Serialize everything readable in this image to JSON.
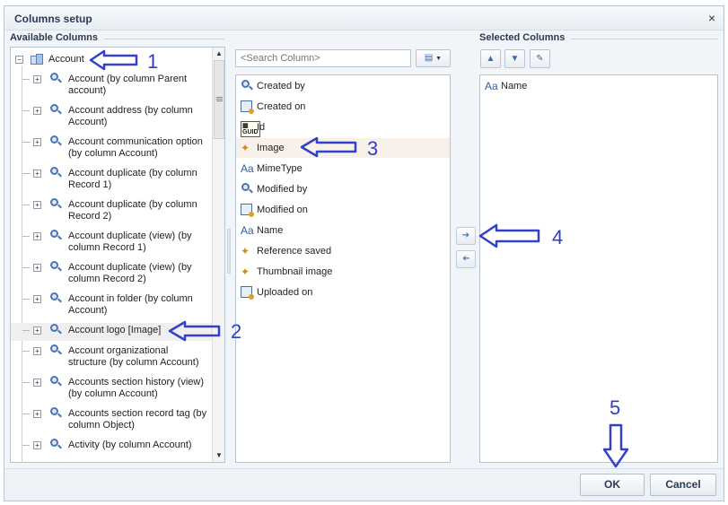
{
  "dialog": {
    "title": "Columns setup",
    "close_glyph": "×"
  },
  "available": {
    "label": "Available Columns",
    "root_label": "Account",
    "items": [
      {
        "label": "Account (by column Parent account)",
        "lines": [
          "Account (by column Parent",
          "account)"
        ]
      },
      {
        "label": "Account address (by column Account)",
        "lines": [
          "Account address (by column",
          "Account)"
        ]
      },
      {
        "label": "Account communication option (by column Account)",
        "lines": [
          "Account communication option",
          "(by column Account)"
        ]
      },
      {
        "label": "Account duplicate (by column Record 1)",
        "lines": [
          "Account duplicate (by column",
          "Record 1)"
        ]
      },
      {
        "label": "Account duplicate (by column Record 2)",
        "lines": [
          "Account duplicate (by column",
          "Record 2)"
        ]
      },
      {
        "label": "Account duplicate (view) (by column Record 1)",
        "lines": [
          "Account duplicate (view) (by",
          "column Record 1)"
        ]
      },
      {
        "label": "Account duplicate (view) (by column Record 2)",
        "lines": [
          "Account duplicate (view) (by",
          "column Record 2)"
        ]
      },
      {
        "label": "Account in folder (by column Account)",
        "lines": [
          "Account in folder (by column",
          "Account)"
        ]
      },
      {
        "label": "Account logo [Image]",
        "lines": [
          "Account logo [Image]"
        ]
      },
      {
        "label": "Account organizational structure (by column Account)",
        "lines": [
          "Account organizational",
          "structure (by column Account)"
        ]
      },
      {
        "label": "Accounts section history (view) (by column Account)",
        "lines": [
          "Accounts section history (view)",
          "(by column Account)"
        ]
      },
      {
        "label": "Accounts section record tag (by column Object)",
        "lines": [
          "Accounts section record tag (by",
          "column Object)"
        ]
      },
      {
        "label": "Activity (by column Account)",
        "lines": [
          "Activity (by column Account)"
        ]
      }
    ]
  },
  "middle": {
    "search_placeholder": "<Search Column>",
    "columns": [
      {
        "label": "Created by",
        "icon": "lookup-icon"
      },
      {
        "label": "Created on",
        "icon": "datetime-icon"
      },
      {
        "label": "Id",
        "icon": "guid-icon"
      },
      {
        "label": "Image",
        "icon": "image-icon"
      },
      {
        "label": "MimeType",
        "icon": "text-icon"
      },
      {
        "label": "Modified by",
        "icon": "lookup-icon"
      },
      {
        "label": "Modified on",
        "icon": "datetime-icon"
      },
      {
        "label": "Name",
        "icon": "text-icon"
      },
      {
        "label": "Reference saved",
        "icon": "image-icon"
      },
      {
        "label": "Thumbnail image",
        "icon": "image-icon"
      },
      {
        "label": "Uploaded on",
        "icon": "datetime-icon"
      }
    ]
  },
  "selected": {
    "label": "Selected Columns",
    "columns": [
      {
        "label": "Name",
        "icon": "text-icon"
      }
    ]
  },
  "buttons": {
    "ok": "OK",
    "cancel": "Cancel"
  },
  "annotations": [
    "1",
    "2",
    "3",
    "4",
    "5"
  ],
  "colors": {
    "annotation": "#2d3fc4",
    "accent": "#2b3b55"
  }
}
